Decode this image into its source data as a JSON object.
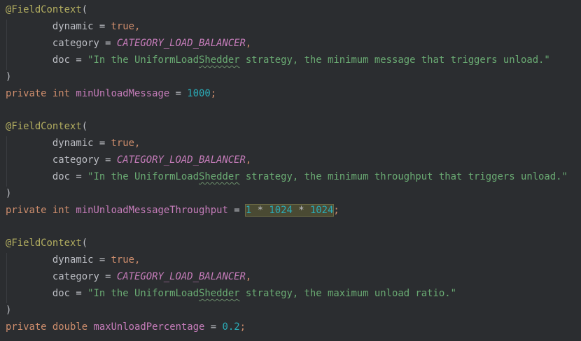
{
  "blocks": [
    {
      "annotation": "@FieldContext",
      "open_paren": "(",
      "dynamic_key": "dynamic",
      "dynamic_value": "true",
      "category_key": "category",
      "category_value": "CATEGORY_LOAD_BALANCER",
      "doc_key": "doc",
      "doc_prefix": "\"In the UniformLoad",
      "doc_typo": "Shedder",
      "doc_suffix": " strategy, the minimum message that triggers unload.\"",
      "close_paren": ")",
      "modifier": "private",
      "type": "int",
      "field_name": "minUnloadMessage",
      "value_parts": [
        "1000"
      ]
    },
    {
      "annotation": "@FieldContext",
      "open_paren": "(",
      "dynamic_key": "dynamic",
      "dynamic_value": "true",
      "category_key": "category",
      "category_value": "CATEGORY_LOAD_BALANCER",
      "doc_key": "doc",
      "doc_prefix": "\"In the UniformLoad",
      "doc_typo": "Shedder",
      "doc_suffix": " strategy, the minimum throughput that triggers unload.\"",
      "close_paren": ")",
      "modifier": "private",
      "type": "int",
      "field_name": "minUnloadMessageThroughput",
      "value_parts": [
        "1",
        "1024",
        "1024"
      ]
    },
    {
      "annotation": "@FieldContext",
      "open_paren": "(",
      "dynamic_key": "dynamic",
      "dynamic_value": "true",
      "category_key": "category",
      "category_value": "CATEGORY_LOAD_BALANCER",
      "doc_key": "doc",
      "doc_prefix": "\"In the UniformLoad",
      "doc_typo": "Shedder",
      "doc_suffix": " strategy, the maximum unload ratio.\"",
      "close_paren": ")",
      "modifier": "private",
      "type": "double",
      "field_name": "maxUnloadPercentage",
      "value_parts": [
        "0.2"
      ]
    }
  ],
  "symbols": {
    "equals": " = ",
    "comma": ",",
    "semicolon": ";",
    "times": " * ",
    "indent": "        "
  },
  "colors": {
    "background": "#2b2d30",
    "annotation": "#b3ae60",
    "keyword": "#cf8e6d",
    "constant": "#c77dbb",
    "string": "#6aab73",
    "number": "#2aacb8",
    "text": "#bcbec4"
  }
}
